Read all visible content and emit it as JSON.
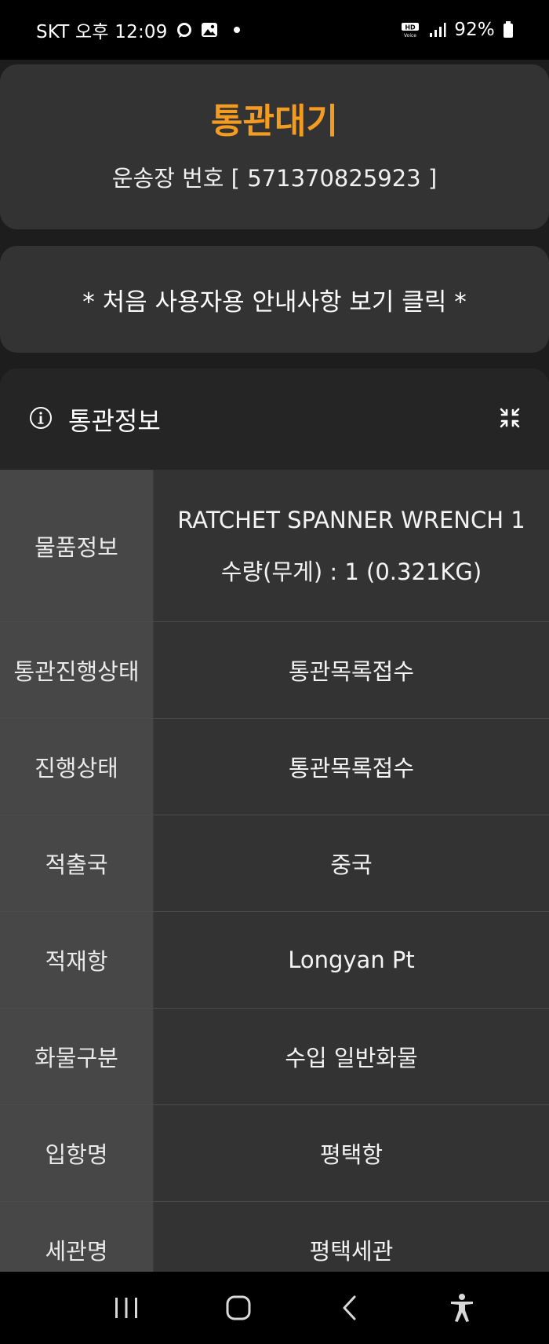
{
  "statusbar": {
    "carrier_time": "SKT 오후 12:09",
    "battery": "92%",
    "icons": [
      "chat-bubble-icon",
      "image-icon",
      "dot-icon",
      "hd-voice-icon",
      "signal-icon",
      "battery-icon"
    ]
  },
  "status_card": {
    "title": "통관대기",
    "tracking": "운송장 번호 [ 571370825923 ]",
    "title_color": "#f59b1f"
  },
  "guide_card": {
    "label": "* 처음 사용자용 안내사항 보기 클릭 *"
  },
  "info": {
    "title": "통관정보",
    "rows": [
      {
        "label": "물품정보",
        "values": [
          "RATCHET SPANNER WRENCH 1",
          "수량(무게) : 1 (0.321KG)"
        ]
      },
      {
        "label": "통관진행상태",
        "values": [
          "통관목록접수"
        ]
      },
      {
        "label": "진행상태",
        "values": [
          "통관목록접수"
        ]
      },
      {
        "label": "적출국",
        "values": [
          "중국"
        ]
      },
      {
        "label": "적재항",
        "values": [
          "Longyan Pt"
        ]
      },
      {
        "label": "화물구분",
        "values": [
          "수입 일반화물"
        ]
      },
      {
        "label": "입항명",
        "values": [
          "평택항"
        ]
      },
      {
        "label": "세관명",
        "values": [
          "평택세관"
        ]
      }
    ]
  },
  "navbar": {
    "buttons": [
      "recent-apps-icon",
      "home-icon",
      "back-icon",
      "accessibility-icon"
    ]
  }
}
